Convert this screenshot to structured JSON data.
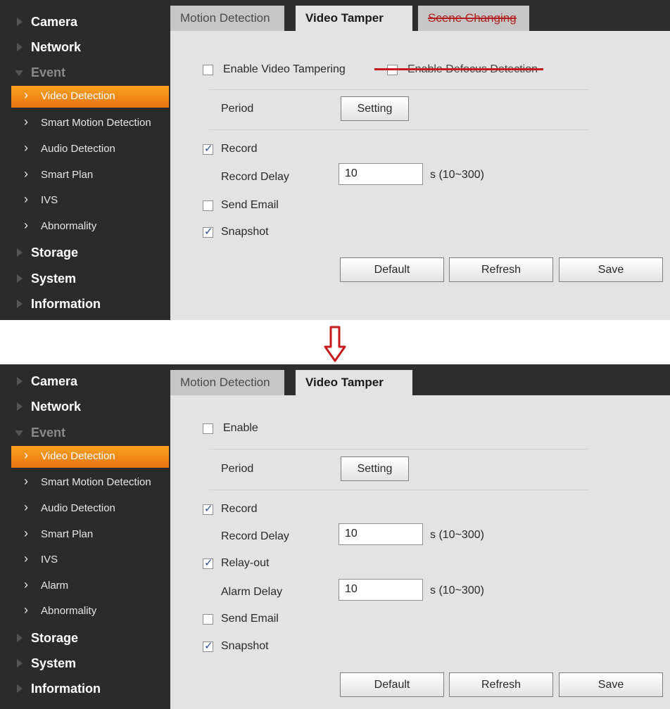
{
  "top": {
    "sidebar": {
      "items": [
        {
          "label": "Camera"
        },
        {
          "label": "Network"
        },
        {
          "label": "Event"
        },
        {
          "label": "Video Detection"
        },
        {
          "label": "Smart Motion Detection"
        },
        {
          "label": "Audio Detection"
        },
        {
          "label": "Smart Plan"
        },
        {
          "label": "IVS"
        },
        {
          "label": "Abnormality"
        },
        {
          "label": "Storage"
        },
        {
          "label": "System"
        },
        {
          "label": "Information"
        }
      ]
    },
    "tabs": [
      "Motion Detection",
      "Video Tamper",
      "Scene Changing"
    ],
    "enable_label": "Enable Video Tampering",
    "defocus_label": "Enable Defocus Detection",
    "period_label": "Period",
    "setting_button": "Setting",
    "record_label": "Record",
    "record_delay_label": "Record Delay",
    "record_delay_value": "10",
    "record_delay_unit": "s (10~300)",
    "send_email_label": "Send Email",
    "snapshot_label": "Snapshot",
    "buttons": {
      "default": "Default",
      "refresh": "Refresh",
      "save": "Save"
    }
  },
  "bottom": {
    "sidebar": {
      "items": [
        {
          "label": "Camera"
        },
        {
          "label": "Network"
        },
        {
          "label": "Event"
        },
        {
          "label": "Video Detection"
        },
        {
          "label": "Smart Motion Detection"
        },
        {
          "label": "Audio Detection"
        },
        {
          "label": "Smart Plan"
        },
        {
          "label": "IVS"
        },
        {
          "label": "Alarm"
        },
        {
          "label": "Abnormality"
        },
        {
          "label": "Storage"
        },
        {
          "label": "System"
        },
        {
          "label": "Information"
        }
      ]
    },
    "tabs": [
      "Motion Detection",
      "Video Tamper"
    ],
    "enable_label": "Enable",
    "period_label": "Period",
    "setting_button": "Setting",
    "record_label": "Record",
    "record_delay_label": "Record Delay",
    "record_delay_value": "10",
    "record_delay_unit": "s (10~300)",
    "relay_label": "Relay-out",
    "alarm_delay_label": "Alarm Delay",
    "alarm_delay_value": "10",
    "alarm_delay_unit": "s (10~300)",
    "send_email_label": "Send Email",
    "snapshot_label": "Snapshot",
    "buttons": {
      "default": "Default",
      "refresh": "Refresh",
      "save": "Save"
    }
  },
  "colors": {
    "active_nav": "#f08a18",
    "strike": "#c61b1b",
    "arrow": "#c61b1b"
  }
}
